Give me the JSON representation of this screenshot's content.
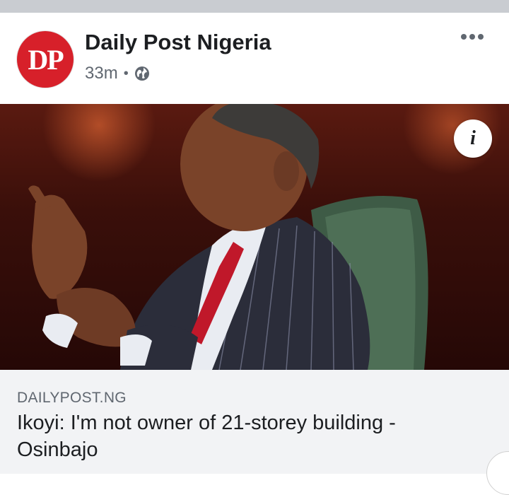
{
  "post": {
    "page_name": "Daily Post Nigeria",
    "avatar_text": "DP",
    "time_ago": "33m",
    "separator": "•",
    "privacy_icon": "globe-icon",
    "more_icon": "more-options-icon"
  },
  "image": {
    "info_label": "i"
  },
  "link": {
    "domain": "DAILYPOST.NG",
    "headline": "Ikoyi: I'm not owner of 21-storey building - Osinbajo"
  },
  "colors": {
    "brand_red": "#d7202a",
    "text_primary": "#1c1e21",
    "text_secondary": "#606770",
    "link_bg": "#f2f3f5"
  }
}
